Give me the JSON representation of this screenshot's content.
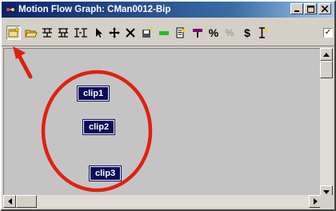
{
  "window": {
    "title": "Motion Flow Graph: CMan0012-Bip",
    "title_icon": "motion-flow-app-icon",
    "caption_buttons": [
      "minimize",
      "maximize",
      "close"
    ]
  },
  "toolbar": {
    "buttons": [
      {
        "name": "create-clip-icon",
        "active": true
      },
      {
        "name": "open-folder-icon"
      },
      {
        "name": "show-transitions-icon"
      },
      {
        "name": "optimize-transitions-icon"
      },
      {
        "name": "create-multiple-clips-icon"
      },
      {
        "name": "select-arrow-icon"
      },
      {
        "name": "move-crosshair-icon"
      },
      {
        "name": "delete-x-icon"
      },
      {
        "name": "save-clip-icon"
      },
      {
        "name": "green-bar-icon"
      },
      {
        "name": "script-document-icon"
      },
      {
        "name": "purple-flag-icon"
      },
      {
        "name": "percent-icon"
      },
      {
        "name": "random-percent-icon"
      },
      {
        "name": "dollar-icon"
      },
      {
        "name": "script-properties-icon"
      }
    ],
    "glyphs": {
      "percent": "%",
      "random": "%",
      "dollar": "$"
    },
    "checkbox_checked": true,
    "checkbox_mark": "✓"
  },
  "clips": [
    {
      "label": "clip1"
    },
    {
      "label": "clip2"
    },
    {
      "label": "clip3"
    }
  ],
  "annotation": {
    "arrow_color": "#e02010",
    "ellipse_color": "#e02010"
  },
  "colors": {
    "titlebar_start": "#0a246a",
    "titlebar_end": "#a6caf0",
    "clip_bg": "#0c0c5a",
    "canvas_bg": "#c4c4c4"
  }
}
